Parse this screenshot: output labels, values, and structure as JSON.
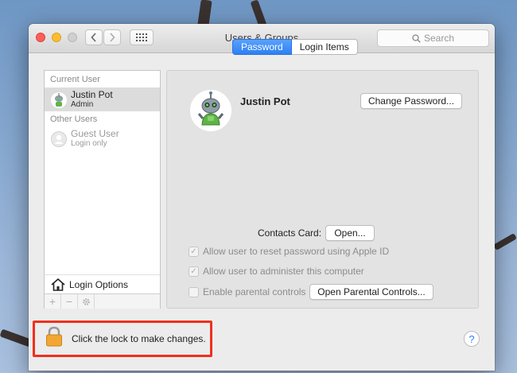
{
  "window": {
    "title": "Users & Groups",
    "search_placeholder": "Search"
  },
  "sidebar": {
    "current_users_label": "Current User",
    "current_user": {
      "name": "Justin Pot",
      "role": "Admin"
    },
    "other_users_label": "Other Users",
    "guest_user": {
      "name": "Guest User",
      "status": "Login only"
    },
    "login_options_label": "Login Options",
    "tools": [
      "+",
      "−",
      "gear"
    ]
  },
  "tabs": [
    {
      "label": "Password",
      "active": true
    },
    {
      "label": "Login Items",
      "active": false
    }
  ],
  "account": {
    "name": "Justin Pot",
    "change_password_label": "Change Password...",
    "contacts_card_label": "Contacts Card:",
    "open_label": "Open...",
    "options": [
      {
        "label": "Allow user to reset password using Apple ID",
        "checked": true
      },
      {
        "label": "Allow user to administer this computer",
        "checked": true
      },
      {
        "label": "Enable parental controls",
        "checked": false
      }
    ],
    "open_parental_controls_label": "Open Parental Controls..."
  },
  "lock": {
    "text": "Click the lock to make changes."
  },
  "help": {
    "label": "?"
  },
  "colors": {
    "accent": "#2d7ff5",
    "highlight": "#f0301d",
    "lock": "#f2a733"
  }
}
